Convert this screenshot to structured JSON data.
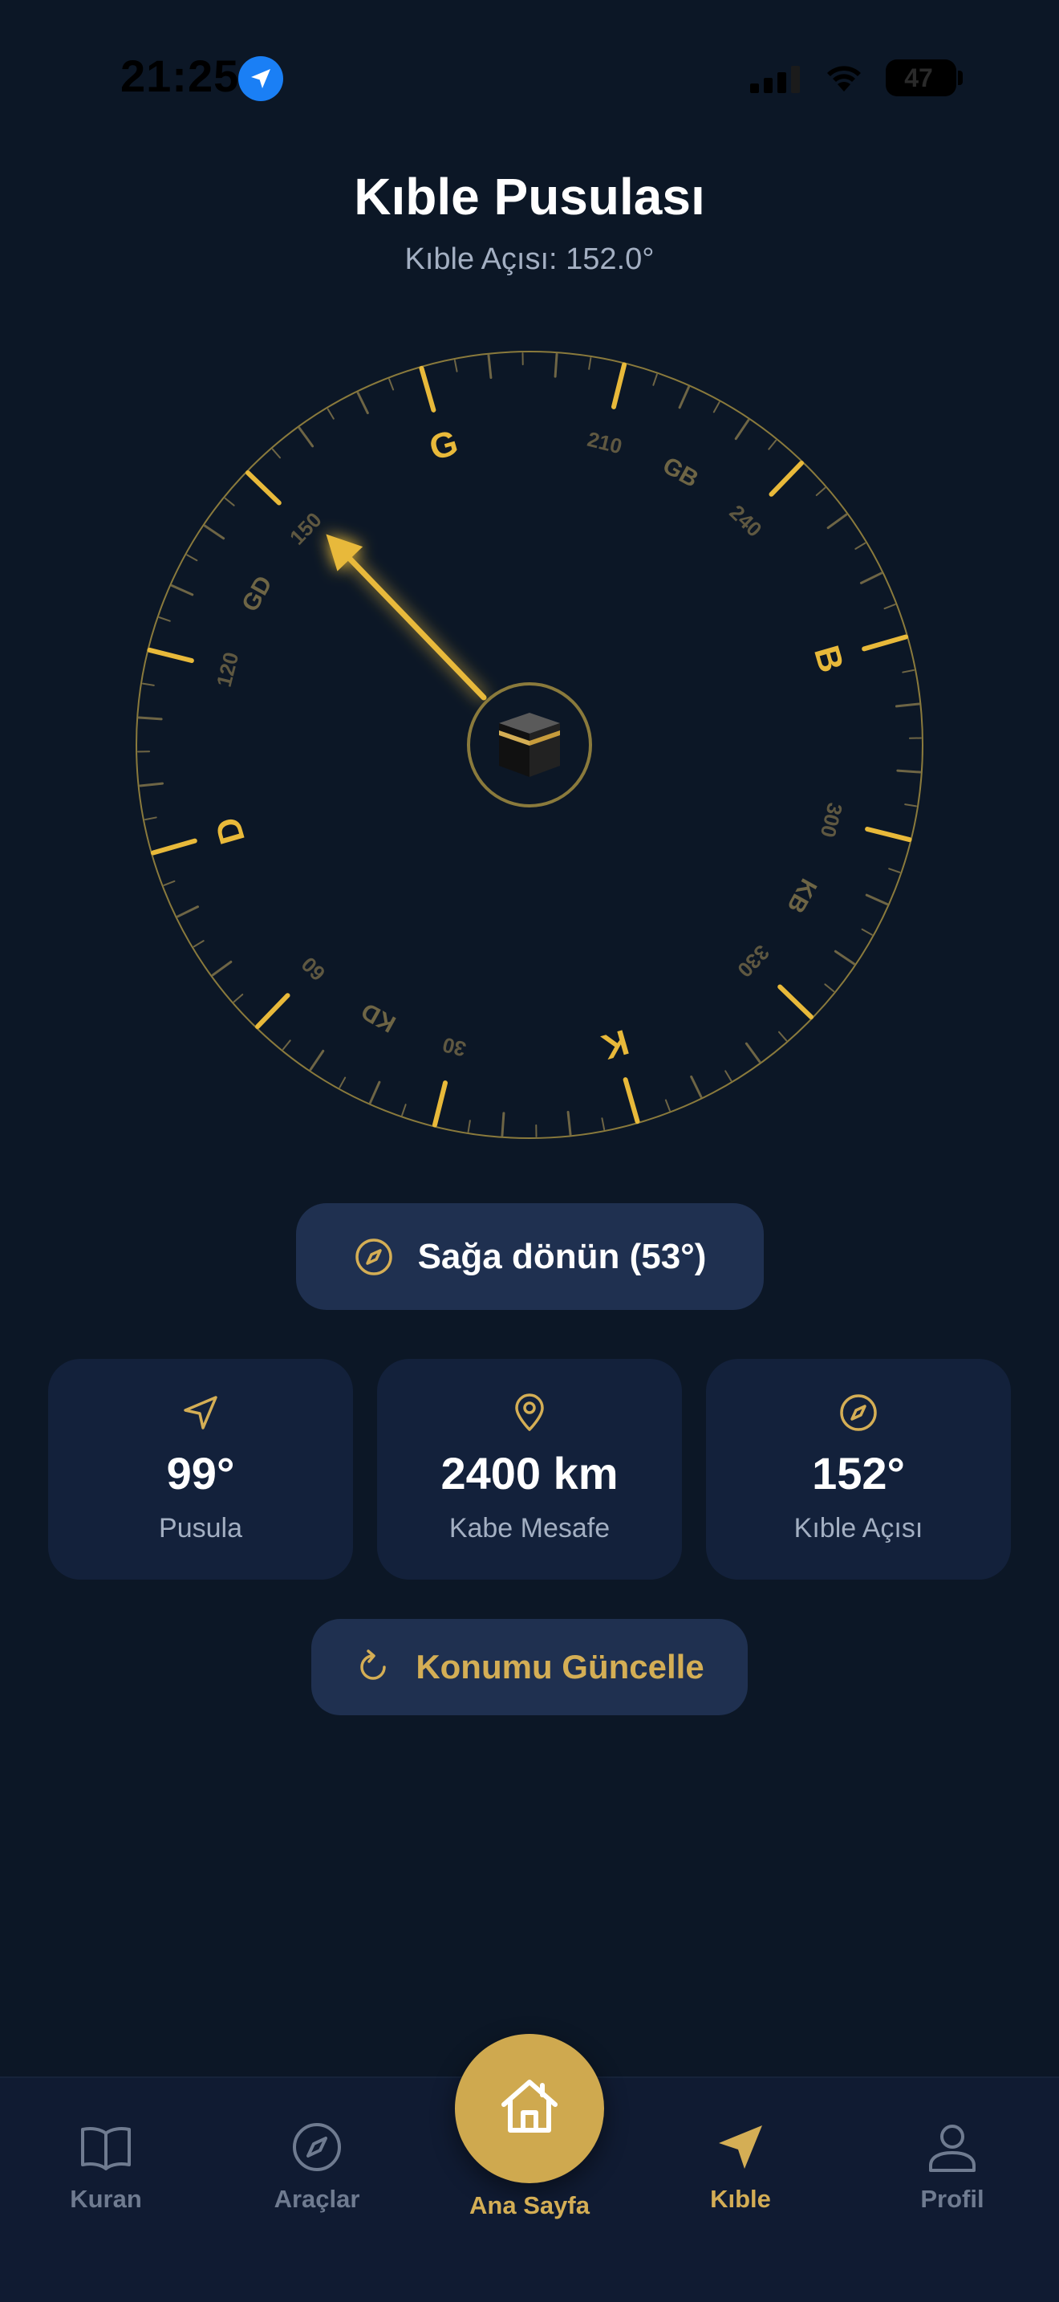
{
  "status_bar": {
    "time": "21:25",
    "battery": "47",
    "location_icon": "location-arrow-icon",
    "signal_icon": "cellular-signal-icon",
    "wifi_icon": "wifi-icon"
  },
  "header": {
    "title": "Kıble Pusulası",
    "subtitle": "Kıble Açısı: 152.0°"
  },
  "compass": {
    "cardinals": {
      "north": "K",
      "east": "D",
      "south": "G",
      "west": "B"
    },
    "intercardinals": {
      "northeast": "KD",
      "southeast": "GD",
      "southwest": "GB",
      "northwest": "KB"
    },
    "degree_labels": [
      "30",
      "60",
      "120",
      "150",
      "210",
      "240",
      "300",
      "330"
    ],
    "device_heading_deg": 99,
    "qibla_bearing_deg": 152,
    "center_icon": "kaaba-icon",
    "colors": {
      "accent": "#e8b93a",
      "ring": "#8a7a3c",
      "muted": "#6e6545"
    }
  },
  "turn_hint": {
    "icon": "compass-icon",
    "text": "Sağa dönün (53°)"
  },
  "stats": [
    {
      "icon": "navigation-arrow-icon",
      "value": "99°",
      "label": "Pusula"
    },
    {
      "icon": "map-pin-icon",
      "value": "2400 km",
      "label": "Kabe Mesafe"
    },
    {
      "icon": "compass-icon",
      "value": "152°",
      "label": "Kıble Açısı"
    }
  ],
  "refresh_button": {
    "icon": "refresh-icon",
    "label": "Konumu Güncelle"
  },
  "tab_bar": {
    "items": [
      {
        "icon": "book-open-icon",
        "label": "Kuran",
        "active": false
      },
      {
        "icon": "compass-icon",
        "label": "Araçlar",
        "active": false
      },
      {
        "icon": "home-icon",
        "label": "Ana Sayfa",
        "active": false
      },
      {
        "icon": "navigation-arrow-icon",
        "label": "Kıble",
        "active": true
      },
      {
        "icon": "user-icon",
        "label": "Profil",
        "active": false
      }
    ]
  },
  "colors": {
    "background": "#0c1726",
    "card": "#13213b",
    "pill": "#1f3050",
    "gold": "#d4ae55",
    "muted_text": "#a3afc2"
  }
}
